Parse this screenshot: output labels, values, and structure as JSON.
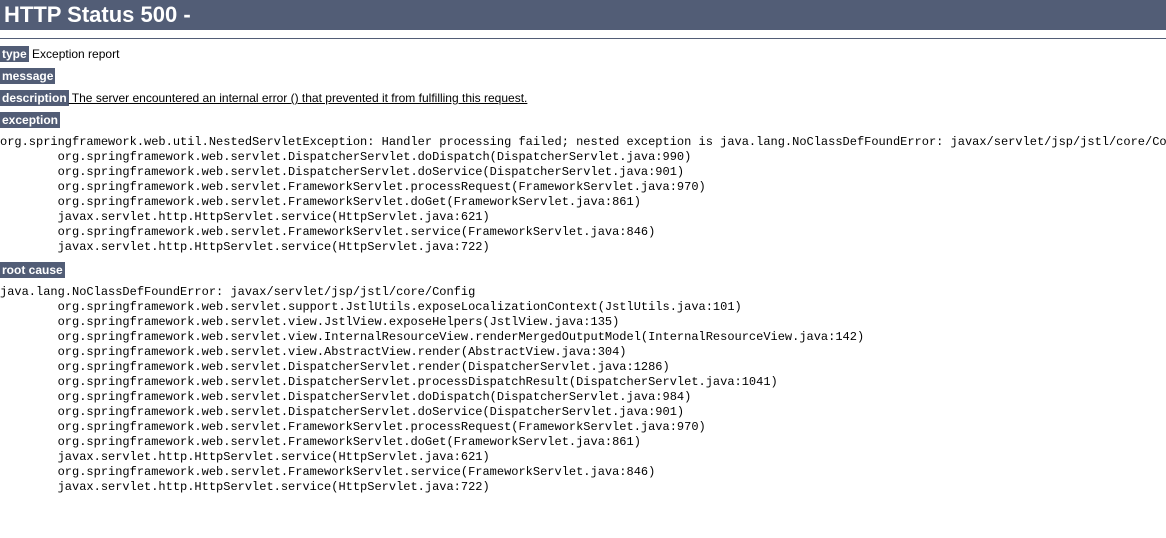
{
  "header": {
    "title": "HTTP Status 500 -"
  },
  "sections": {
    "type_label": "type",
    "type_value": " Exception report",
    "message_label": "message",
    "description_label": "description",
    "description_value": " The server encountered an internal error () that prevented it from fulfilling this request.",
    "exception_label": "exception",
    "root_cause_label": "root cause"
  },
  "exception_trace": "org.springframework.web.util.NestedServletException: Handler processing failed; nested exception is java.lang.NoClassDefFoundError: javax/servlet/jsp/jstl/core/Config\n\torg.springframework.web.servlet.DispatcherServlet.doDispatch(DispatcherServlet.java:990)\n\torg.springframework.web.servlet.DispatcherServlet.doService(DispatcherServlet.java:901)\n\torg.springframework.web.servlet.FrameworkServlet.processRequest(FrameworkServlet.java:970)\n\torg.springframework.web.servlet.FrameworkServlet.doGet(FrameworkServlet.java:861)\n\tjavax.servlet.http.HttpServlet.service(HttpServlet.java:621)\n\torg.springframework.web.servlet.FrameworkServlet.service(FrameworkServlet.java:846)\n\tjavax.servlet.http.HttpServlet.service(HttpServlet.java:722)",
  "root_cause_trace": "java.lang.NoClassDefFoundError: javax/servlet/jsp/jstl/core/Config\n\torg.springframework.web.servlet.support.JstlUtils.exposeLocalizationContext(JstlUtils.java:101)\n\torg.springframework.web.servlet.view.JstlView.exposeHelpers(JstlView.java:135)\n\torg.springframework.web.servlet.view.InternalResourceView.renderMergedOutputModel(InternalResourceView.java:142)\n\torg.springframework.web.servlet.view.AbstractView.render(AbstractView.java:304)\n\torg.springframework.web.servlet.DispatcherServlet.render(DispatcherServlet.java:1286)\n\torg.springframework.web.servlet.DispatcherServlet.processDispatchResult(DispatcherServlet.java:1041)\n\torg.springframework.web.servlet.DispatcherServlet.doDispatch(DispatcherServlet.java:984)\n\torg.springframework.web.servlet.DispatcherServlet.doService(DispatcherServlet.java:901)\n\torg.springframework.web.servlet.FrameworkServlet.processRequest(FrameworkServlet.java:970)\n\torg.springframework.web.servlet.FrameworkServlet.doGet(FrameworkServlet.java:861)\n\tjavax.servlet.http.HttpServlet.service(HttpServlet.java:621)\n\torg.springframework.web.servlet.FrameworkServlet.service(FrameworkServlet.java:846)\n\tjavax.servlet.http.HttpServlet.service(HttpServlet.java:722)"
}
